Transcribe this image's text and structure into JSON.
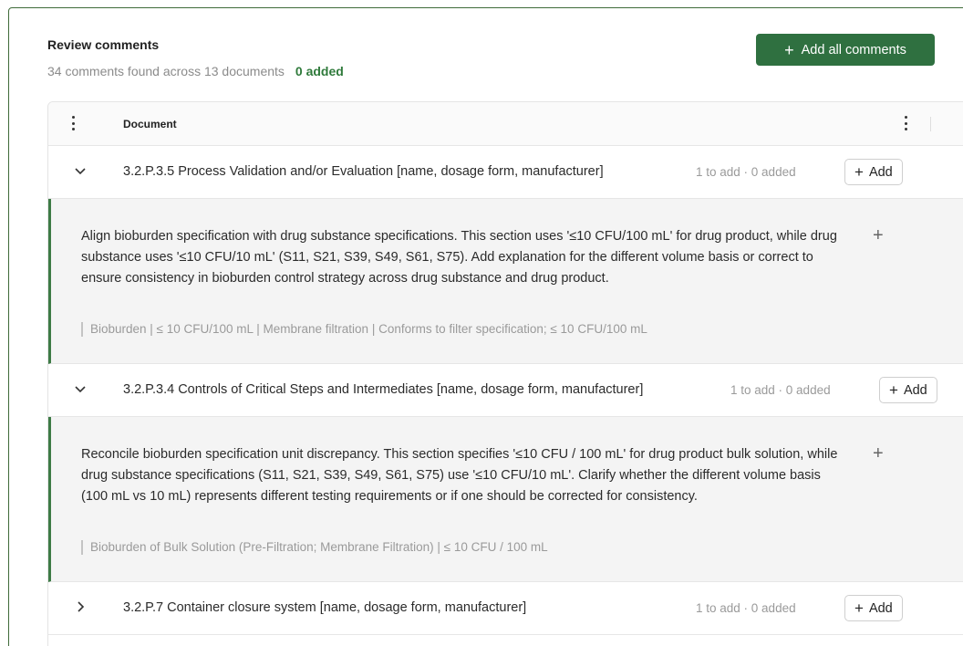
{
  "header": {
    "title": "Review comments",
    "summary": "34 comments found across 13 documents",
    "added": "0 added",
    "add_all_label": "Add all comments"
  },
  "table": {
    "column_document": "Document"
  },
  "rows": [
    {
      "title": "3.2.P.3.5 Process Validation and/or Evaluation [name, dosage form, manufacturer]",
      "stats": "1 to add · 0 added",
      "add_label": "Add",
      "expanded": true,
      "comment": {
        "text": "Align bioburden specification with drug substance specifications. This section uses '≤10 CFU/100 mL' for drug product, while drug substance uses '≤10 CFU/10 mL' (S11, S21, S39, S49, S61, S75). Add explanation for the different volume basis or correct to ensure consistency in bioburden control strategy across drug substance and drug product.",
        "ref": "Bioburden | ≤ 10 CFU/100 mL | Membrane filtration | Conforms to filter specification; ≤ 10 CFU/100 mL"
      }
    },
    {
      "title": "3.2.P.3.4 Controls of Critical Steps and Intermediates [name, dosage form, manufacturer]",
      "stats": "1 to add · 0 added",
      "add_label": "Add",
      "expanded": true,
      "comment": {
        "text": "Reconcile bioburden specification unit discrepancy. This section specifies '≤10 CFU / 100 mL' for drug product bulk solution, while drug substance specifications (S11, S21, S39, S49, S61, S75) use '≤10 CFU/10 mL'. Clarify whether the different volume basis (100 mL vs 10 mL) represents different testing requirements or if one should be corrected for consistency.",
        "ref": "Bioburden of Bulk Solution (Pre-Filtration; Membrane Filtration) | ≤ 10 CFU / 100 mL"
      }
    },
    {
      "title": "3.2.P.7 Container closure system [name, dosage form, manufacturer]",
      "stats": "1 to add · 0 added",
      "add_label": "Add",
      "expanded": false
    }
  ],
  "icons": {
    "chevron_expanded": "chevron-down-icon",
    "chevron_collapsed": "chevron-right-icon",
    "plus": "plus-icon",
    "column_menu": "kebab-icon"
  },
  "colors": {
    "accent": "#2f7040",
    "frame_border": "#3f6b3a",
    "comment_bar": "#3d7a45",
    "added_text": "#2f7a3b"
  }
}
